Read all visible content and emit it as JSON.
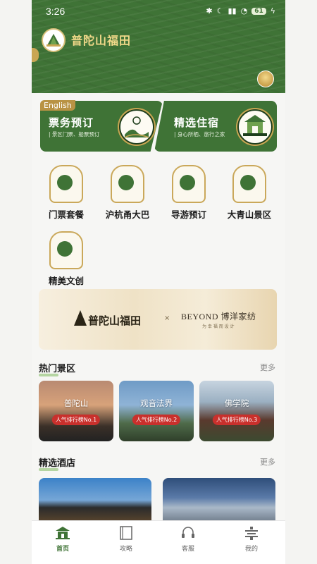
{
  "status_bar": {
    "time": "3:26",
    "battery": "61"
  },
  "header": {
    "brand": "普陀山福田"
  },
  "promos": [
    {
      "title": "票务预订",
      "subtitle": "| 景区门票、船票预订",
      "tag": "English"
    },
    {
      "title": "精选住宿",
      "subtitle": "| 身心所栖、旅行之家"
    }
  ],
  "categories": [
    {
      "label": "门票套餐",
      "icon": "ticket-gate-icon"
    },
    {
      "label": "沪杭甬大巴",
      "icon": "bus-icon"
    },
    {
      "label": "导游预订",
      "icon": "guide-icon"
    },
    {
      "label": "大青山景区",
      "icon": "mountain-icon"
    },
    {
      "label": "精美文创",
      "icon": "lotus-icon"
    }
  ],
  "banner": {
    "brand": "普陀山福田",
    "x": "×",
    "partner": "BEYOND 博洋家纺",
    "slogan": "为 幸 福 而 设 计"
  },
  "hot_scenic": {
    "title": "热门景区",
    "more": "更多",
    "items": [
      {
        "name": "普陀山",
        "rank": "人气排行榜No.1"
      },
      {
        "name": "观音法界",
        "rank": "人气排行榜No.2"
      },
      {
        "name": "佛学院",
        "rank": "人气排行榜No.3"
      }
    ]
  },
  "hotels": {
    "title": "精选酒店",
    "more": "更多"
  },
  "tabs": [
    {
      "label": "首页",
      "icon": "home-temple-icon",
      "active": true
    },
    {
      "label": "攻略",
      "icon": "guide-book-icon"
    },
    {
      "label": "客服",
      "icon": "headset-icon"
    },
    {
      "label": "我的",
      "icon": "user-profile-icon"
    }
  ],
  "colors": {
    "primary": "#3f7336",
    "gold": "#c9a653",
    "rank_red": "#c9302c"
  }
}
